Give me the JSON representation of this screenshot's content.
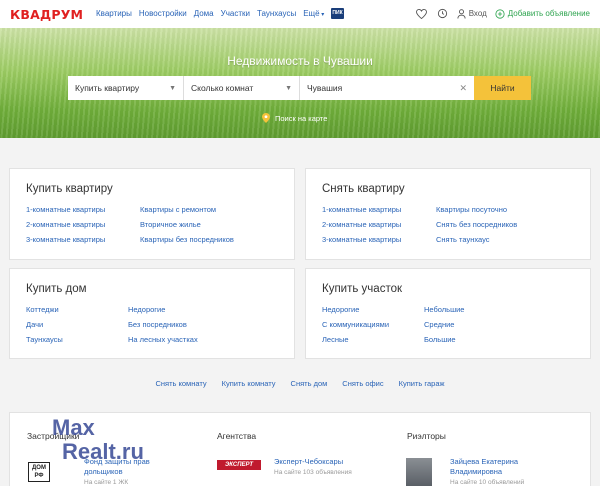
{
  "header": {
    "logo": "КВАДРУМ",
    "nav": [
      "Квартиры",
      "Новостройки",
      "Дома",
      "Участки",
      "Таунхаусы",
      "Ещё"
    ],
    "pik_label": "ПИК",
    "login": "Вход",
    "add_listing": "Добавить объявление"
  },
  "hero": {
    "title": "Недвижимость в Чувашии",
    "deal_select": "Купить квартиру",
    "rooms_select": "Сколько комнат",
    "location_value": "Чувашия",
    "search_button": "Найти",
    "map_link": "Поиск на карте"
  },
  "cards": {
    "buy_flat": {
      "title": "Купить квартиру",
      "col1": [
        "1-комнатные квартиры",
        "2-комнатные квартиры",
        "3-комнатные квартиры"
      ],
      "col2": [
        "Квартиры с ремонтом",
        "Вторичное жилье",
        "Квартиры без посредников"
      ]
    },
    "rent_flat": {
      "title": "Снять квартиру",
      "col1": [
        "1-комнатные квартиры",
        "2-комнатные квартиры",
        "3-комнатные квартиры"
      ],
      "col2": [
        "Квартиры посуточно",
        "Снять без посредников",
        "Снять таунхаус"
      ]
    },
    "buy_house": {
      "title": "Купить дом",
      "col1": [
        "Коттеджи",
        "Дачи",
        "Таунхаусы"
      ],
      "col2": [
        "Недорогие",
        "Без посредников",
        "На лесных участках"
      ]
    },
    "buy_land": {
      "title": "Купить участок",
      "col1": [
        "Недорогие",
        "С коммуникациями",
        "Лесные"
      ],
      "col2": [
        "Небольшие",
        "Средние",
        "Большие"
      ]
    }
  },
  "quick_links": [
    "Снять комнату",
    "Купить комнату",
    "Снять дом",
    "Снять офис",
    "Купить гараж"
  ],
  "bottom": {
    "developers_title": "Застройщики",
    "agencies_title": "Агентства",
    "realtors_title": "Риэлторы",
    "dev_logo": "ДОМ РФ",
    "dev_name": "Фонд защиты прав дольщиков",
    "dev_sub": "На сайте 1 ЖК",
    "agency_logo": "ЭКСПЕРТ",
    "agency_name": "Эксперт-Чебоксары",
    "agency_sub": "На сайте 103 объявления",
    "realtor_name": "Зайцева Екатерина Владимировна",
    "realtor_sub": "На сайте 10 объявлений"
  },
  "watermark": [
    "Max",
    "Realt.ru"
  ],
  "colors": {
    "logo": "#e02020",
    "link": "#2a64b7",
    "search_button": "#f4c23a",
    "add_listing": "#2ea44f"
  }
}
